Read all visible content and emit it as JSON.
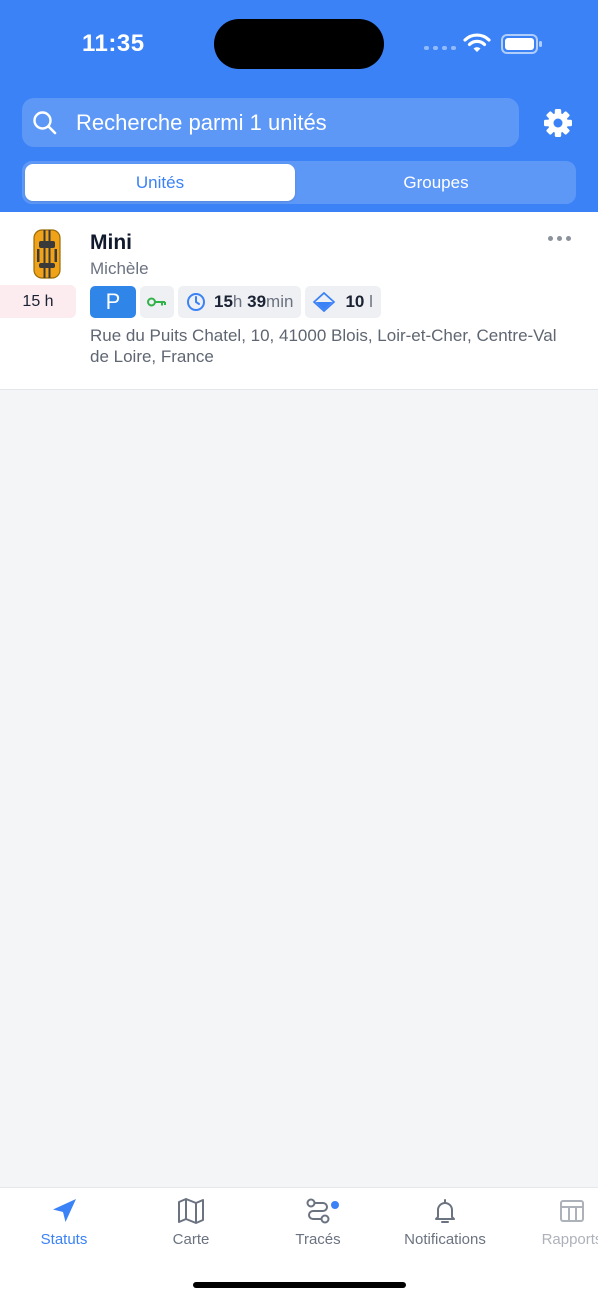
{
  "status_bar": {
    "time": "11:35"
  },
  "search": {
    "placeholder": "Recherche parmi 1 unités"
  },
  "segments": {
    "active": "Unités",
    "inactive": "Groupes"
  },
  "unit": {
    "name": "Mini",
    "driver": "Michèle",
    "last_message": "15 h",
    "state_badge": "P",
    "duration_hours": "15",
    "duration_hours_unit": "h",
    "duration_minutes": "39",
    "duration_minutes_unit": "min",
    "fuel_value": "10",
    "fuel_unit": "l",
    "address": "Rue du Puits Chatel, 10, 41000 Blois, Loir-et-Cher, Centre-Val de Loire, France"
  },
  "tabs": [
    {
      "label": "Statuts",
      "icon": "navigation-arrow-icon",
      "active": true
    },
    {
      "label": "Carte",
      "icon": "map-icon",
      "active": false
    },
    {
      "label": "Tracés",
      "icon": "route-icon",
      "active": false,
      "dot": true
    },
    {
      "label": "Notifications",
      "icon": "bell-icon",
      "active": false
    },
    {
      "label": "Rapports",
      "icon": "table-icon",
      "active": false
    }
  ],
  "colors": {
    "header": "#3b82f6",
    "accent": "#3b82f6",
    "parking_badge": "#2f86e8",
    "key_ignition": "#34b24a",
    "time_badge_bg": "#fdecef"
  }
}
